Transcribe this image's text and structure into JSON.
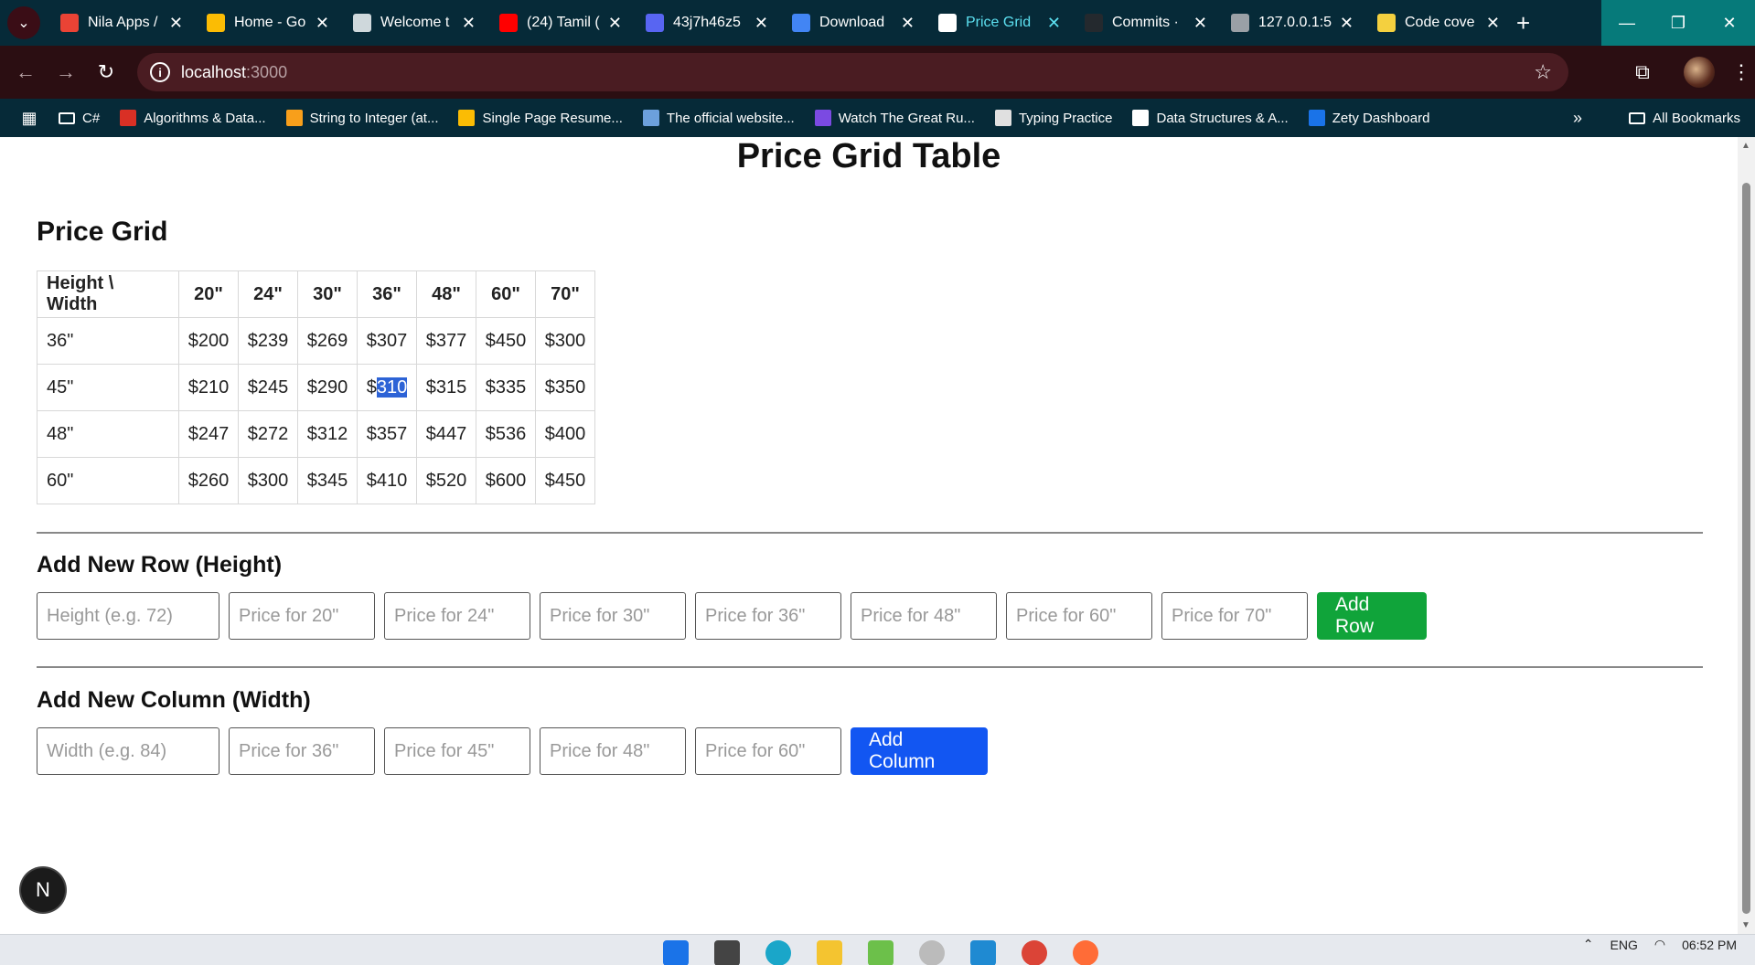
{
  "browser": {
    "tabs": [
      {
        "title": "Nila Apps /",
        "icon": "gmail-icon",
        "color": "#ea4335"
      },
      {
        "title": "Home - Go",
        "icon": "drive-icon",
        "color": "#fbbc04"
      },
      {
        "title": "Welcome t",
        "icon": "openai-icon",
        "color": "#cfd8dc"
      },
      {
        "title": "(24) Tamil (",
        "icon": "youtube-icon",
        "color": "#ff0000"
      },
      {
        "title": "43j7h46z5",
        "icon": "code-icon",
        "color": "#5865f2"
      },
      {
        "title": "Download",
        "icon": "download-icon",
        "color": "#4285f4"
      },
      {
        "title": "Price Grid",
        "icon": "triangle-icon",
        "color": "#ffffff",
        "active": true
      },
      {
        "title": "Commits ·",
        "icon": "github-icon",
        "color": "#24292e"
      },
      {
        "title": "127.0.0.1:5",
        "icon": "globe-icon",
        "color": "#9aa0a6"
      },
      {
        "title": "Code cove",
        "icon": "coverage-icon",
        "color": "#f4d03f"
      }
    ],
    "new_tab_label": "+",
    "address": {
      "host": "localhost",
      "port": ":3000"
    },
    "bookmarks": [
      {
        "label": "C#",
        "icon": "folder-icon"
      },
      {
        "label": "Algorithms & Data...",
        "icon": "gfg-icon",
        "color": "#d93025"
      },
      {
        "label": "String to Integer (at...",
        "icon": "leetcode-icon",
        "color": "#f89f1b"
      },
      {
        "label": "Single Page Resume...",
        "icon": "doc-icon",
        "color": "#fbbc04"
      },
      {
        "label": "The official website...",
        "icon": "site-icon",
        "color": "#6ca0dc"
      },
      {
        "label": "Watch The Great Ru...",
        "icon": "w-icon",
        "color": "#7b4ae2"
      },
      {
        "label": "Typing Practice",
        "icon": "typing-icon",
        "color": "#e0e0e0"
      },
      {
        "label": "Data Structures & A...",
        "icon": "ds-icon",
        "color": "#ffffff"
      },
      {
        "label": "Zety Dashboard",
        "icon": "zety-icon",
        "color": "#1a73e8"
      }
    ],
    "more_bookmarks": "»",
    "all_bookmarks": "All Bookmarks"
  },
  "page": {
    "title": "Price Grid Table",
    "grid_heading": "Price Grid",
    "corner_label": "Height \\ Width",
    "widths": [
      "20\"",
      "24\"",
      "30\"",
      "36\"",
      "48\"",
      "60\"",
      "70\""
    ],
    "rows": [
      {
        "height": "36\"",
        "prices": [
          "$200",
          "$239",
          "$269",
          "$307",
          "$377",
          "$450",
          "$300"
        ]
      },
      {
        "height": "45\"",
        "prices": [
          "$210",
          "$245",
          "$290",
          "$310",
          "$315",
          "$335",
          "$350"
        ]
      },
      {
        "height": "48\"",
        "prices": [
          "$247",
          "$272",
          "$312",
          "$357",
          "$447",
          "$536",
          "$400"
        ]
      },
      {
        "height": "60\"",
        "prices": [
          "$260",
          "$300",
          "$345",
          "$410",
          "$520",
          "$600",
          "$450"
        ]
      }
    ],
    "add_row": {
      "heading": "Add New Row (Height)",
      "height_placeholder": "Height (e.g. 72)",
      "price_placeholders": [
        "Price for 20\"",
        "Price for 24\"",
        "Price for 30\"",
        "Price for 36\"",
        "Price for 48\"",
        "Price for 60\"",
        "Price for 70\""
      ],
      "button": "Add Row",
      "button_color": "#10a43a"
    },
    "add_column": {
      "heading": "Add New Column (Width)",
      "width_placeholder": "Width (e.g. 84)",
      "price_placeholders": [
        "Price for 36\"",
        "Price for 45\"",
        "Price for 48\"",
        "Price for 60\""
      ],
      "button": "Add Column",
      "button_color": "#1256f2"
    },
    "next_badge": "N"
  },
  "taskbar": {
    "language": "ENG",
    "time": "06:52 PM"
  }
}
